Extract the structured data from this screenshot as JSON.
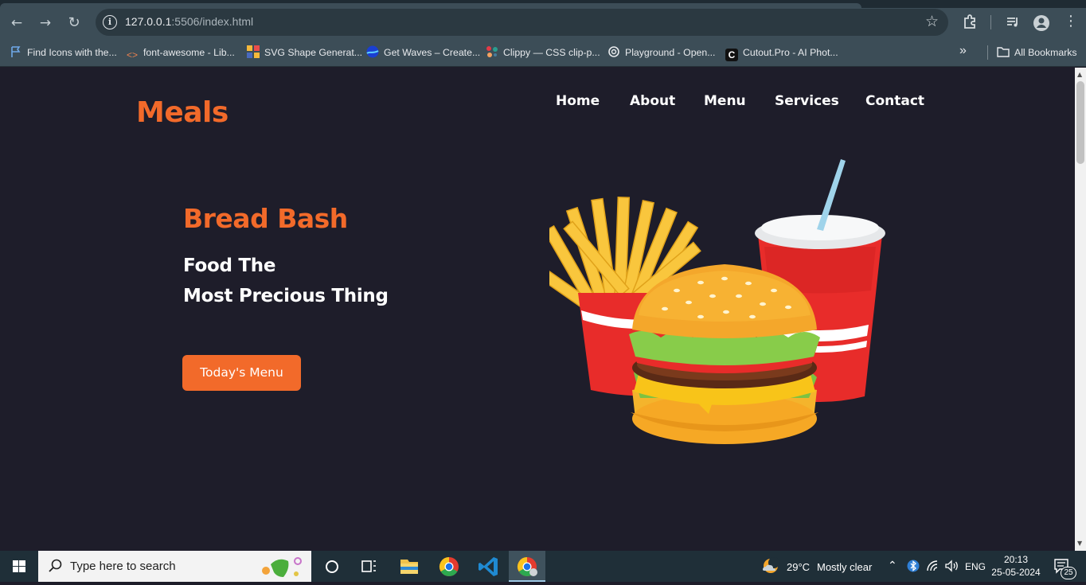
{
  "browser": {
    "url_host": "127.0.0.1",
    "url_rest": ":5506/index.html",
    "bookmarks": [
      "Find Icons with the...",
      "font-awesome - Lib...",
      "SVG Shape Generat...",
      "Get Waves – Create...",
      "Clippy — CSS clip-p...",
      "Playground - Open...",
      "Cutout.Pro - AI Phot..."
    ],
    "all_bookmarks": "All Bookmarks",
    "overflow": "»"
  },
  "site": {
    "logo": "Meals",
    "nav": [
      "Home",
      "About",
      "Menu",
      "Services",
      "Contact"
    ],
    "hero_title": "Bread Bash",
    "hero_line1": "Food The",
    "hero_line2": "Most Precious Thing",
    "cta": "Today's Menu"
  },
  "taskbar": {
    "search_placeholder": "Type here to search",
    "weather_temp": "29°C",
    "weather_desc": "Mostly clear",
    "language": "ENG",
    "time": "20:13",
    "date": "25-05-2024",
    "notifications": "25"
  },
  "colors": {
    "accent": "#f26a2a",
    "page_bg": "#1e1d2a",
    "chrome": "#3c4d57"
  }
}
